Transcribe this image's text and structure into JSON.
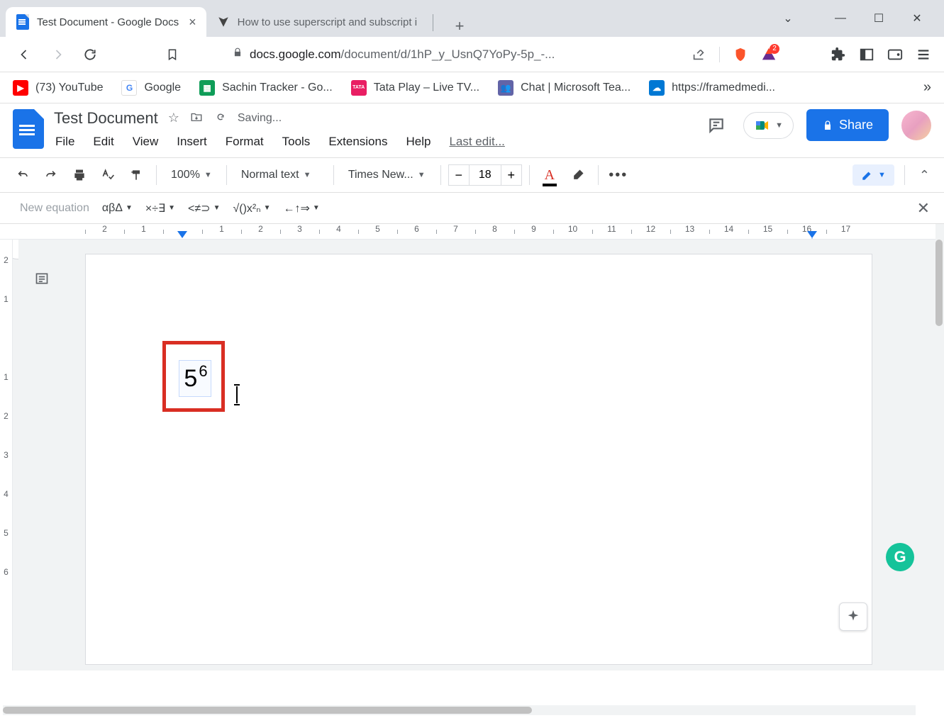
{
  "browser": {
    "tabs": [
      {
        "title": "Test Document - Google Docs",
        "active": true
      },
      {
        "title": "How to use superscript and subscript i",
        "active": false
      }
    ],
    "url_prefix": "docs.google.com",
    "url_rest": "/document/d/1hP_y_UsnQ7YoPy-5p_-...",
    "bookmarks": [
      {
        "label": "(73) YouTube",
        "color": "#ff0000"
      },
      {
        "label": "Google",
        "color": "#fff"
      },
      {
        "label": "Sachin Tracker - Go...",
        "color": "#0f9d58"
      },
      {
        "label": "Tata Play – Live TV...",
        "color": "#e91e63"
      },
      {
        "label": "Chat | Microsoft Tea...",
        "color": "#6264a7"
      },
      {
        "label": "https://framedmedi...",
        "color": "#0078d4"
      }
    ]
  },
  "docs": {
    "title": "Test Document",
    "saving": "Saving...",
    "menus": [
      "File",
      "Edit",
      "View",
      "Insert",
      "Format",
      "Tools",
      "Extensions",
      "Help"
    ],
    "last_edit": "Last edit...",
    "share": "Share"
  },
  "toolbar": {
    "zoom": "100%",
    "style": "Normal text",
    "font": "Times New...",
    "size": "18"
  },
  "equation": {
    "new_label": "New equation",
    "groups": [
      "αβΔ",
      "×÷∃",
      "<≠⊃",
      "√()x²ₙ",
      "←↑⇒"
    ]
  },
  "ruler_h": [
    "2",
    "1",
    "",
    "1",
    "2",
    "3",
    "4",
    "5",
    "6",
    "7",
    "8",
    "9",
    "10",
    "11",
    "12",
    "13",
    "14",
    "15",
    "16",
    "17"
  ],
  "ruler_v": [
    "2",
    "1",
    "",
    "1",
    "2",
    "3",
    "4",
    "5",
    "6"
  ],
  "content": {
    "base": "5",
    "superscript": "6"
  }
}
